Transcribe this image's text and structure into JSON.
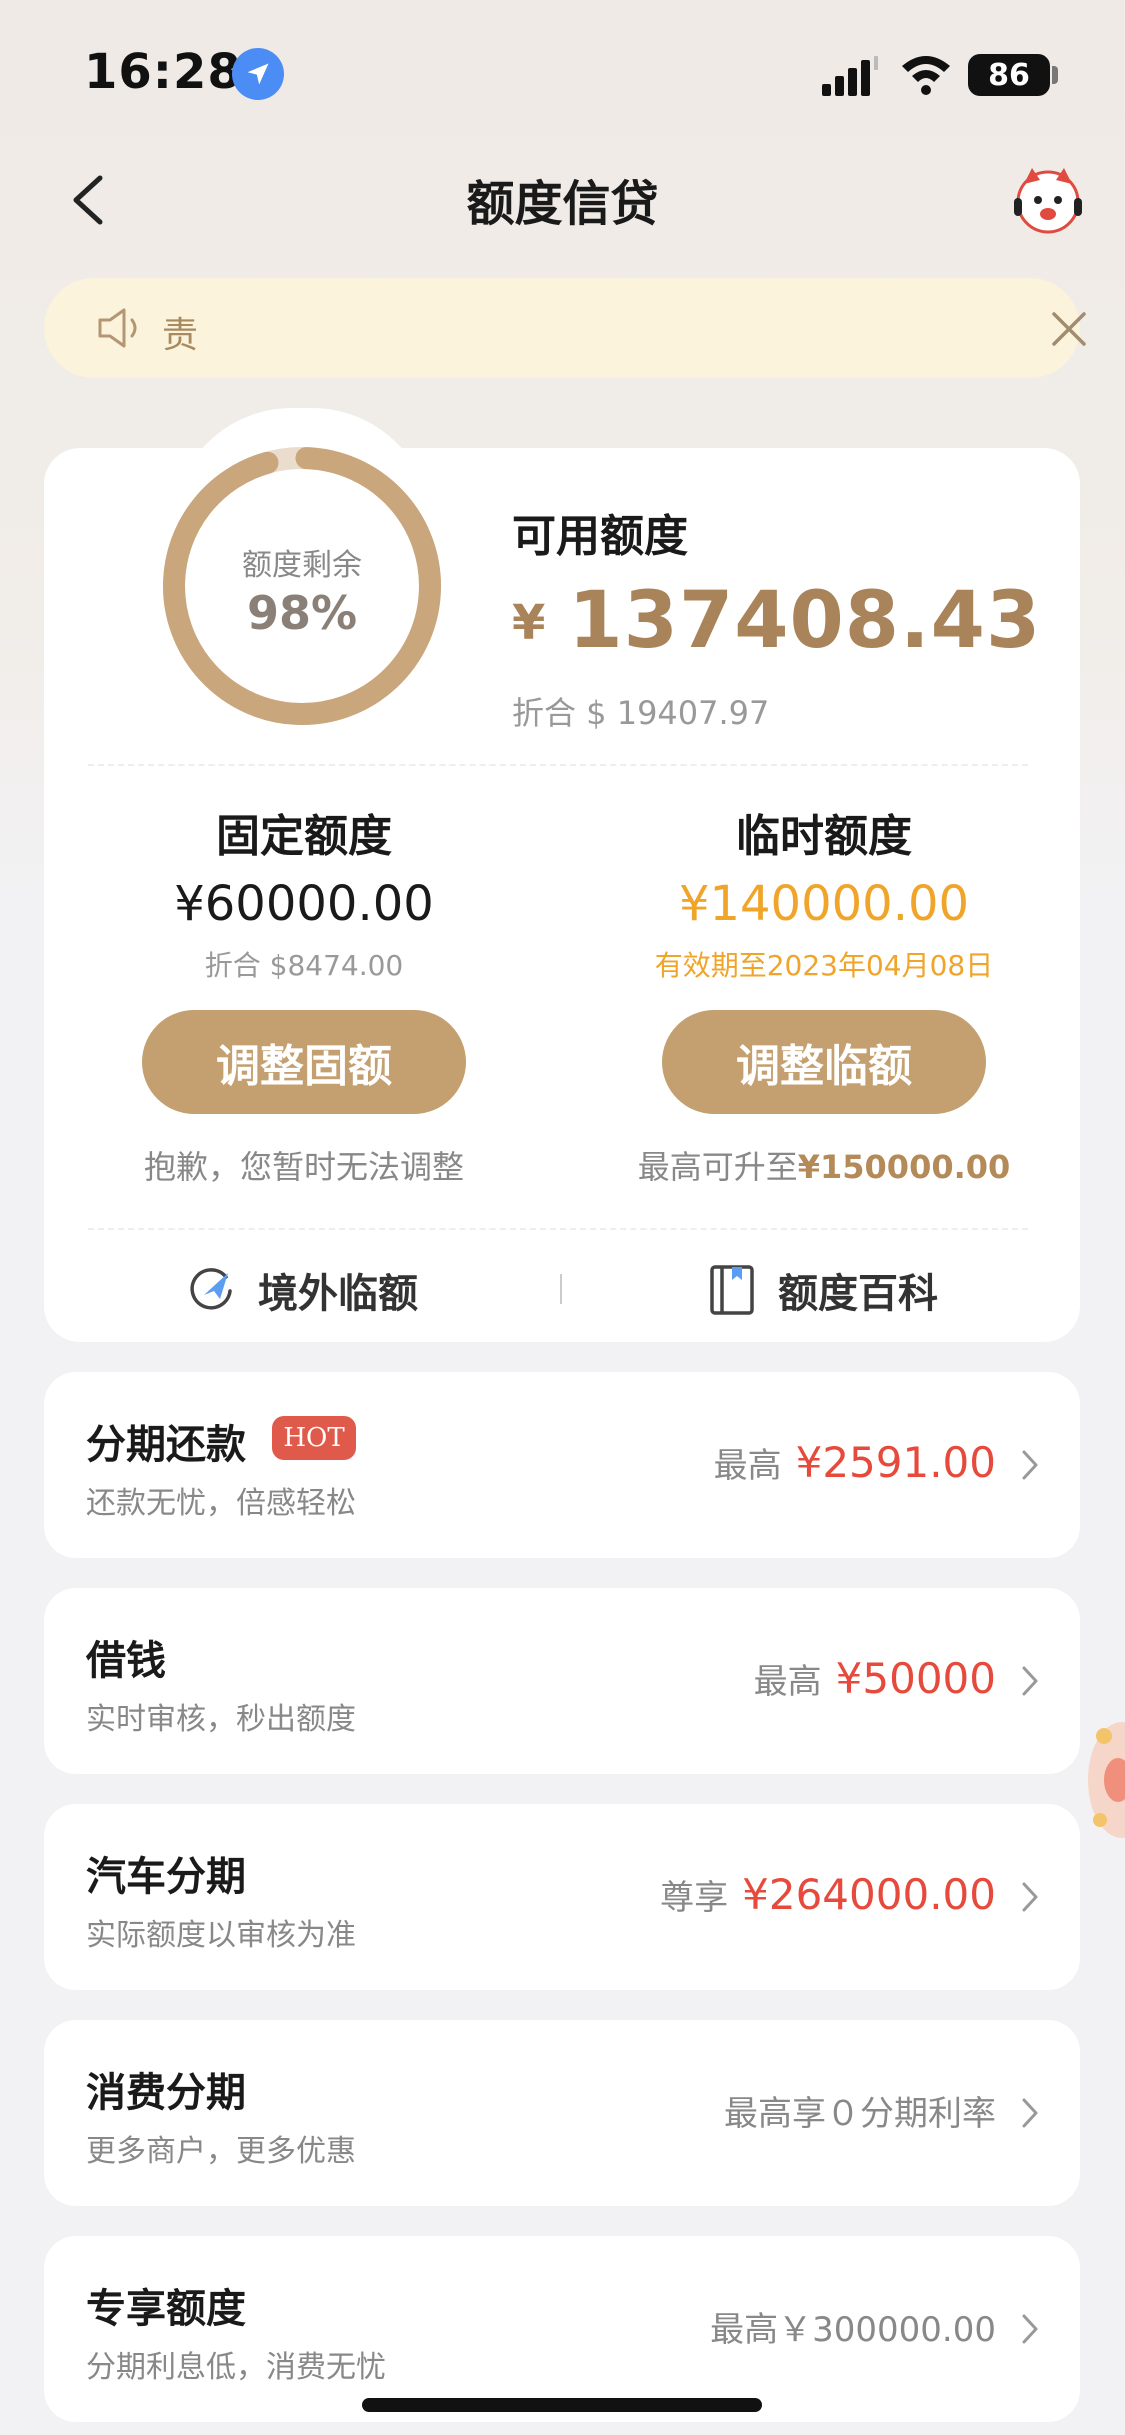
{
  "status_bar": {
    "time": "16:28",
    "battery": "86"
  },
  "nav": {
    "title": "额度信贷"
  },
  "notice": {
    "text": "责"
  },
  "credit": {
    "ring_label": "额度剩余",
    "ring_percent_text": "98%",
    "remaining_fraction": 0.98,
    "available_label": "可用额度",
    "available_currency": "¥",
    "available_amount": "137408.43",
    "available_usd": "折合 $ 19407.97",
    "fixed": {
      "title": "固定额度",
      "amount": "¥60000.00",
      "sub": "折合 $8474.00",
      "button": "调整固额",
      "note": "抱歉，您暂时无法调整"
    },
    "temp": {
      "title": "临时额度",
      "amount": "¥140000.00",
      "sub": "有效期至2023年04月08日",
      "button": "调整临额",
      "note_prefix": "最高可升至",
      "note_amount": "¥150000.00"
    },
    "links": [
      {
        "label": "境外临额",
        "icon": "overseas-plane-icon"
      },
      {
        "label": "额度百科",
        "icon": "book-icon"
      }
    ]
  },
  "services": [
    {
      "title": "分期还款",
      "badge": "HOT",
      "subtitle": "还款无忧，倍感轻松",
      "right_label": "最高",
      "right_value": "¥2591.00"
    },
    {
      "title": "借钱",
      "subtitle": "实时审核，秒出额度",
      "right_label": "最高",
      "right_value": "¥50000"
    },
    {
      "title": "汽车分期",
      "subtitle": "实际额度以审核为准",
      "right_label": "尊享",
      "right_value": "¥264000.00"
    },
    {
      "title": "消费分期",
      "subtitle": "更多商户，更多优惠",
      "right_label": "最高享０分期利率",
      "right_value": ""
    },
    {
      "title": "专享额度",
      "subtitle": "分期利息低，消费无忧",
      "right_label": "最高￥300000.00",
      "right_value": ""
    }
  ],
  "colors": {
    "gold": "#c4a070",
    "accent_red": "#e64a3c",
    "orange": "#f0a52a"
  }
}
